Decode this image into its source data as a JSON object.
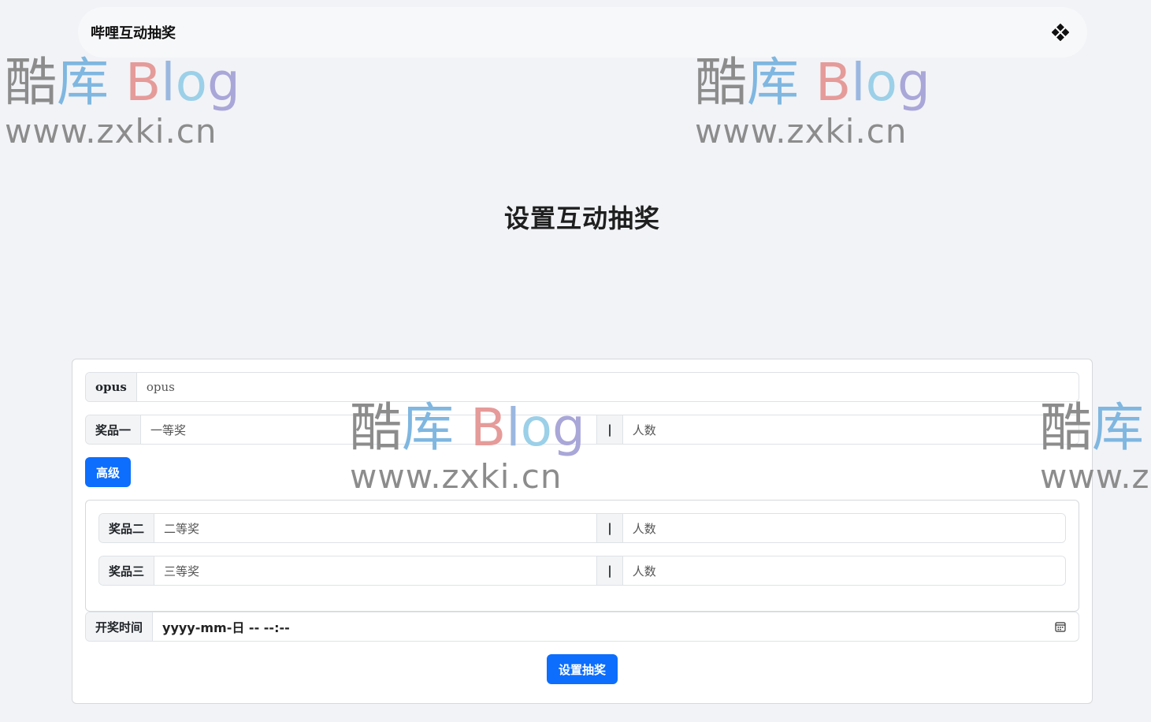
{
  "navbar": {
    "brand": "哔哩互动抽奖",
    "theme_toggle_icon": "theme-toggle-icon"
  },
  "page": {
    "title": "设置互动抽奖"
  },
  "form": {
    "opus": {
      "label": "opus",
      "placeholder": "opus"
    },
    "prize1": {
      "label": "奖品一",
      "name_placeholder": "一等奖",
      "separator": "|",
      "count_placeholder": "人数"
    },
    "advanced_button": "高级",
    "prize2": {
      "label": "奖品二",
      "name_placeholder": "二等奖",
      "separator": "|",
      "count_placeholder": "人数"
    },
    "prize3": {
      "label": "奖品三",
      "name_placeholder": "三等奖",
      "separator": "|",
      "count_placeholder": "人数"
    },
    "draw_time": {
      "label": "开奖时间",
      "value": "yyyy-mm-日 -- --:--",
      "icon": "calendar-icon"
    },
    "submit_button": "设置抽奖"
  },
  "watermark": {
    "line1_a": "酷",
    "line1_b": "库",
    "line1_c": "B",
    "line1_d": "l",
    "line1_e": "o",
    "line1_f": "g",
    "line2": "www.zxki.cn"
  },
  "colors": {
    "primary": "#0d6efd",
    "background": "#f2f3f7",
    "navbar": "#f7f8fa",
    "border": "#dee2e6"
  }
}
